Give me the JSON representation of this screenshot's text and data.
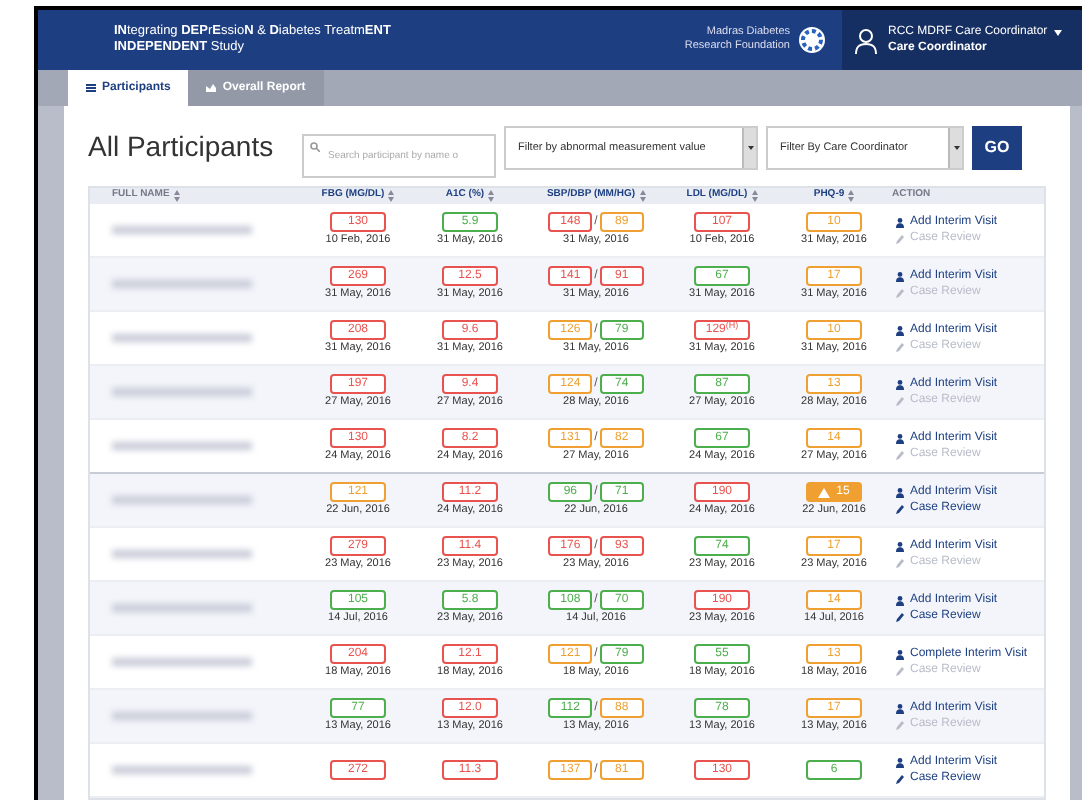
{
  "header": {
    "title": "**IN**tegrating **DEP**r**E**ssio**N** & **D**iabetes Treatm**ENT**",
    "subtitle": "**INDEPENDENT** Study",
    "org": [
      "Madras Diabetes",
      "Research Foundation"
    ],
    "user": "RCC MDRF Care Coordinator",
    "role": "Care Coordinator"
  },
  "tabs": [
    {
      "label": "Participants",
      "selected": true
    },
    {
      "label": "Overall Report",
      "selected": false
    }
  ],
  "bp_separator": "/",
  "page_title": "All Participants",
  "search": {
    "placeholder": "Search participant by name o"
  },
  "filters": [
    "Filter by abnormal measurement value",
    "Filter By Care Coordinator"
  ],
  "go_button": "GO",
  "columns": [
    "FULL NAME",
    "FBG (MG/DL)",
    "A1C (%)",
    "SBP/DBP (MM/HG)",
    "LDL (MG/DL)",
    "PHQ-9",
    "ACTION"
  ],
  "rows": [
    {
      "fbg": {
        "value": "130",
        "color": "#e8534f",
        "date": "10 Feb, 2016"
      },
      "a1c": {
        "value": "5.9",
        "color": "#4cae4c",
        "date": "31 May, 2016"
      },
      "bp": {
        "sys": {
          "value": "148",
          "color": "#e8534f"
        },
        "dia": {
          "value": "89",
          "color": "#f0a030"
        },
        "date": "31 May, 2016"
      },
      "ldl": {
        "value": "107",
        "color": "#e8534f",
        "date": "10 Feb, 2016"
      },
      "phq": {
        "value": "10",
        "color": "#f0a030",
        "alert": false,
        "date": "31 May, 2016"
      },
      "action": {
        "visit": "Add Interim Visit",
        "review": "Case Review",
        "review_enabled": false
      }
    },
    {
      "fbg": {
        "value": "269",
        "color": "#e8534f",
        "date": "31 May, 2016"
      },
      "a1c": {
        "value": "12.5",
        "color": "#e8534f",
        "date": "31 May, 2016"
      },
      "bp": {
        "sys": {
          "value": "141",
          "color": "#e8534f"
        },
        "dia": {
          "value": "91",
          "color": "#e8534f"
        },
        "date": "31 May, 2016"
      },
      "ldl": {
        "value": "67",
        "color": "#4cae4c",
        "date": "31 May, 2016"
      },
      "phq": {
        "value": "17",
        "color": "#f0a030",
        "alert": false,
        "date": "31 May, 2016"
      },
      "action": {
        "visit": "Add Interim Visit",
        "review": "Case Review",
        "review_enabled": false
      }
    },
    {
      "fbg": {
        "value": "208",
        "color": "#e8534f",
        "date": "31 May, 2016"
      },
      "a1c": {
        "value": "9.6",
        "color": "#e8534f",
        "date": "31 May, 2016"
      },
      "bp": {
        "sys": {
          "value": "126",
          "color": "#f0a030"
        },
        "dia": {
          "value": "79",
          "color": "#4cae4c"
        },
        "date": "31 May, 2016"
      },
      "ldl": {
        "value": "129$^{(H)}$",
        "color": "#e8534f",
        "date": "31 May, 2016"
      },
      "phq": {
        "value": "10",
        "color": "#f0a030",
        "alert": false,
        "date": "31 May, 2016"
      },
      "action": {
        "visit": "Add Interim Visit",
        "review": "Case Review",
        "review_enabled": false
      }
    },
    {
      "fbg": {
        "value": "197",
        "color": "#e8534f",
        "date": "27 May, 2016"
      },
      "a1c": {
        "value": "9.4",
        "color": "#e8534f",
        "date": "27 May, 2016"
      },
      "bp": {
        "sys": {
          "value": "124",
          "color": "#f0a030"
        },
        "dia": {
          "value": "74",
          "color": "#4cae4c"
        },
        "date": "28 May, 2016"
      },
      "ldl": {
        "value": "87",
        "color": "#4cae4c",
        "date": "27 May, 2016"
      },
      "phq": {
        "value": "13",
        "color": "#f0a030",
        "alert": false,
        "date": "28 May, 2016"
      },
      "action": {
        "visit": "Add Interim Visit",
        "review": "Case Review",
        "review_enabled": false
      }
    },
    {
      "fbg": {
        "value": "130",
        "color": "#e8534f",
        "date": "24 May, 2016"
      },
      "a1c": {
        "value": "8.2",
        "color": "#e8534f",
        "date": "24 May, 2016"
      },
      "bp": {
        "sys": {
          "value": "131",
          "color": "#f0a030"
        },
        "dia": {
          "value": "82",
          "color": "#f0a030"
        },
        "date": "27 May, 2016"
      },
      "ldl": {
        "value": "67",
        "color": "#4cae4c",
        "date": "24 May, 2016"
      },
      "phq": {
        "value": "14",
        "color": "#f0a030",
        "alert": false,
        "date": "27 May, 2016"
      },
      "action": {
        "visit": "Add Interim Visit",
        "review": "Case Review",
        "review_enabled": false
      }
    },
    {
      "fbg": {
        "value": "121",
        "color": "#f0a030",
        "date": "22 Jun, 2016"
      },
      "a1c": {
        "value": "11.2",
        "color": "#e8534f",
        "date": "24 May, 2016"
      },
      "bp": {
        "sys": {
          "value": "96",
          "color": "#4cae4c"
        },
        "dia": {
          "value": "71",
          "color": "#4cae4c"
        },
        "date": "22 Jun, 2016"
      },
      "ldl": {
        "value": "190",
        "color": "#e8534f",
        "date": "24 May, 2016"
      },
      "phq": {
        "value": "15",
        "color": "#f0a030",
        "alert": true,
        "date": "22 Jun, 2016"
      },
      "action": {
        "visit": "Add Interim Visit",
        "review": "Case Review",
        "review_enabled": true
      }
    },
    {
      "fbg": {
        "value": "279",
        "color": "#e8534f",
        "date": "23 May, 2016"
      },
      "a1c": {
        "value": "11.4",
        "color": "#e8534f",
        "date": "23 May, 2016"
      },
      "bp": {
        "sys": {
          "value": "176",
          "color": "#e8534f"
        },
        "dia": {
          "value": "93",
          "color": "#e8534f"
        },
        "date": "23 May, 2016"
      },
      "ldl": {
        "value": "74",
        "color": "#4cae4c",
        "date": "23 May, 2016"
      },
      "phq": {
        "value": "17",
        "color": "#f0a030",
        "alert": false,
        "date": "23 May, 2016"
      },
      "action": {
        "visit": "Add Interim Visit",
        "review": "Case Review",
        "review_enabled": false
      }
    },
    {
      "fbg": {
        "value": "105",
        "color": "#4cae4c",
        "date": "14 Jul, 2016"
      },
      "a1c": {
        "value": "5.8",
        "color": "#4cae4c",
        "date": "23 May, 2016"
      },
      "bp": {
        "sys": {
          "value": "108",
          "color": "#4cae4c"
        },
        "dia": {
          "value": "70",
          "color": "#4cae4c"
        },
        "date": "14 Jul, 2016"
      },
      "ldl": {
        "value": "190",
        "color": "#e8534f",
        "date": "23 May, 2016"
      },
      "phq": {
        "value": "14",
        "color": "#f0a030",
        "alert": false,
        "date": "14 Jul, 2016"
      },
      "action": {
        "visit": "Add Interim Visit",
        "review": "Case Review",
        "review_enabled": true
      }
    },
    {
      "fbg": {
        "value": "204",
        "color": "#e8534f",
        "date": "18 May, 2016"
      },
      "a1c": {
        "value": "12.1",
        "color": "#e8534f",
        "date": "18 May, 2016"
      },
      "bp": {
        "sys": {
          "value": "121",
          "color": "#f0a030"
        },
        "dia": {
          "value": "79",
          "color": "#4cae4c"
        },
        "date": "18 May, 2016"
      },
      "ldl": {
        "value": "55",
        "color": "#4cae4c",
        "date": "18 May, 2016"
      },
      "phq": {
        "value": "13",
        "color": "#f0a030",
        "alert": false,
        "date": "18 May, 2016"
      },
      "action": {
        "visit": "Complete Interim Visit",
        "review": "Case Review",
        "review_enabled": false
      }
    },
    {
      "fbg": {
        "value": "77",
        "color": "#4cae4c",
        "date": "13 May, 2016"
      },
      "a1c": {
        "value": "12.0",
        "color": "#e8534f",
        "date": "13 May, 2016"
      },
      "bp": {
        "sys": {
          "value": "112",
          "color": "#4cae4c"
        },
        "dia": {
          "value": "88",
          "color": "#f0a030"
        },
        "date": "13 May, 2016"
      },
      "ldl": {
        "value": "78",
        "color": "#4cae4c",
        "date": "13 May, 2016"
      },
      "phq": {
        "value": "17",
        "color": "#f0a030",
        "alert": false,
        "date": "13 May, 2016"
      },
      "action": {
        "visit": "Add Interim Visit",
        "review": "Case Review",
        "review_enabled": false
      }
    },
    {
      "fbg": {
        "value": "272",
        "color": "#e8534f"
      },
      "a1c": {
        "value": "11.3",
        "color": "#e8534f"
      },
      "bp": {
        "sys": {
          "value": "137",
          "color": "#f0a030"
        },
        "dia": {
          "value": "81",
          "color": "#f0a030"
        }
      },
      "ldl": {
        "value": "130",
        "color": "#e8534f"
      },
      "phq": {
        "value": "6",
        "color": "#4cae4c",
        "alert": false
      },
      "action": {
        "visit": "Add Interim Visit",
        "review": "Case Review",
        "review_enabled": true
      }
    }
  ]
}
